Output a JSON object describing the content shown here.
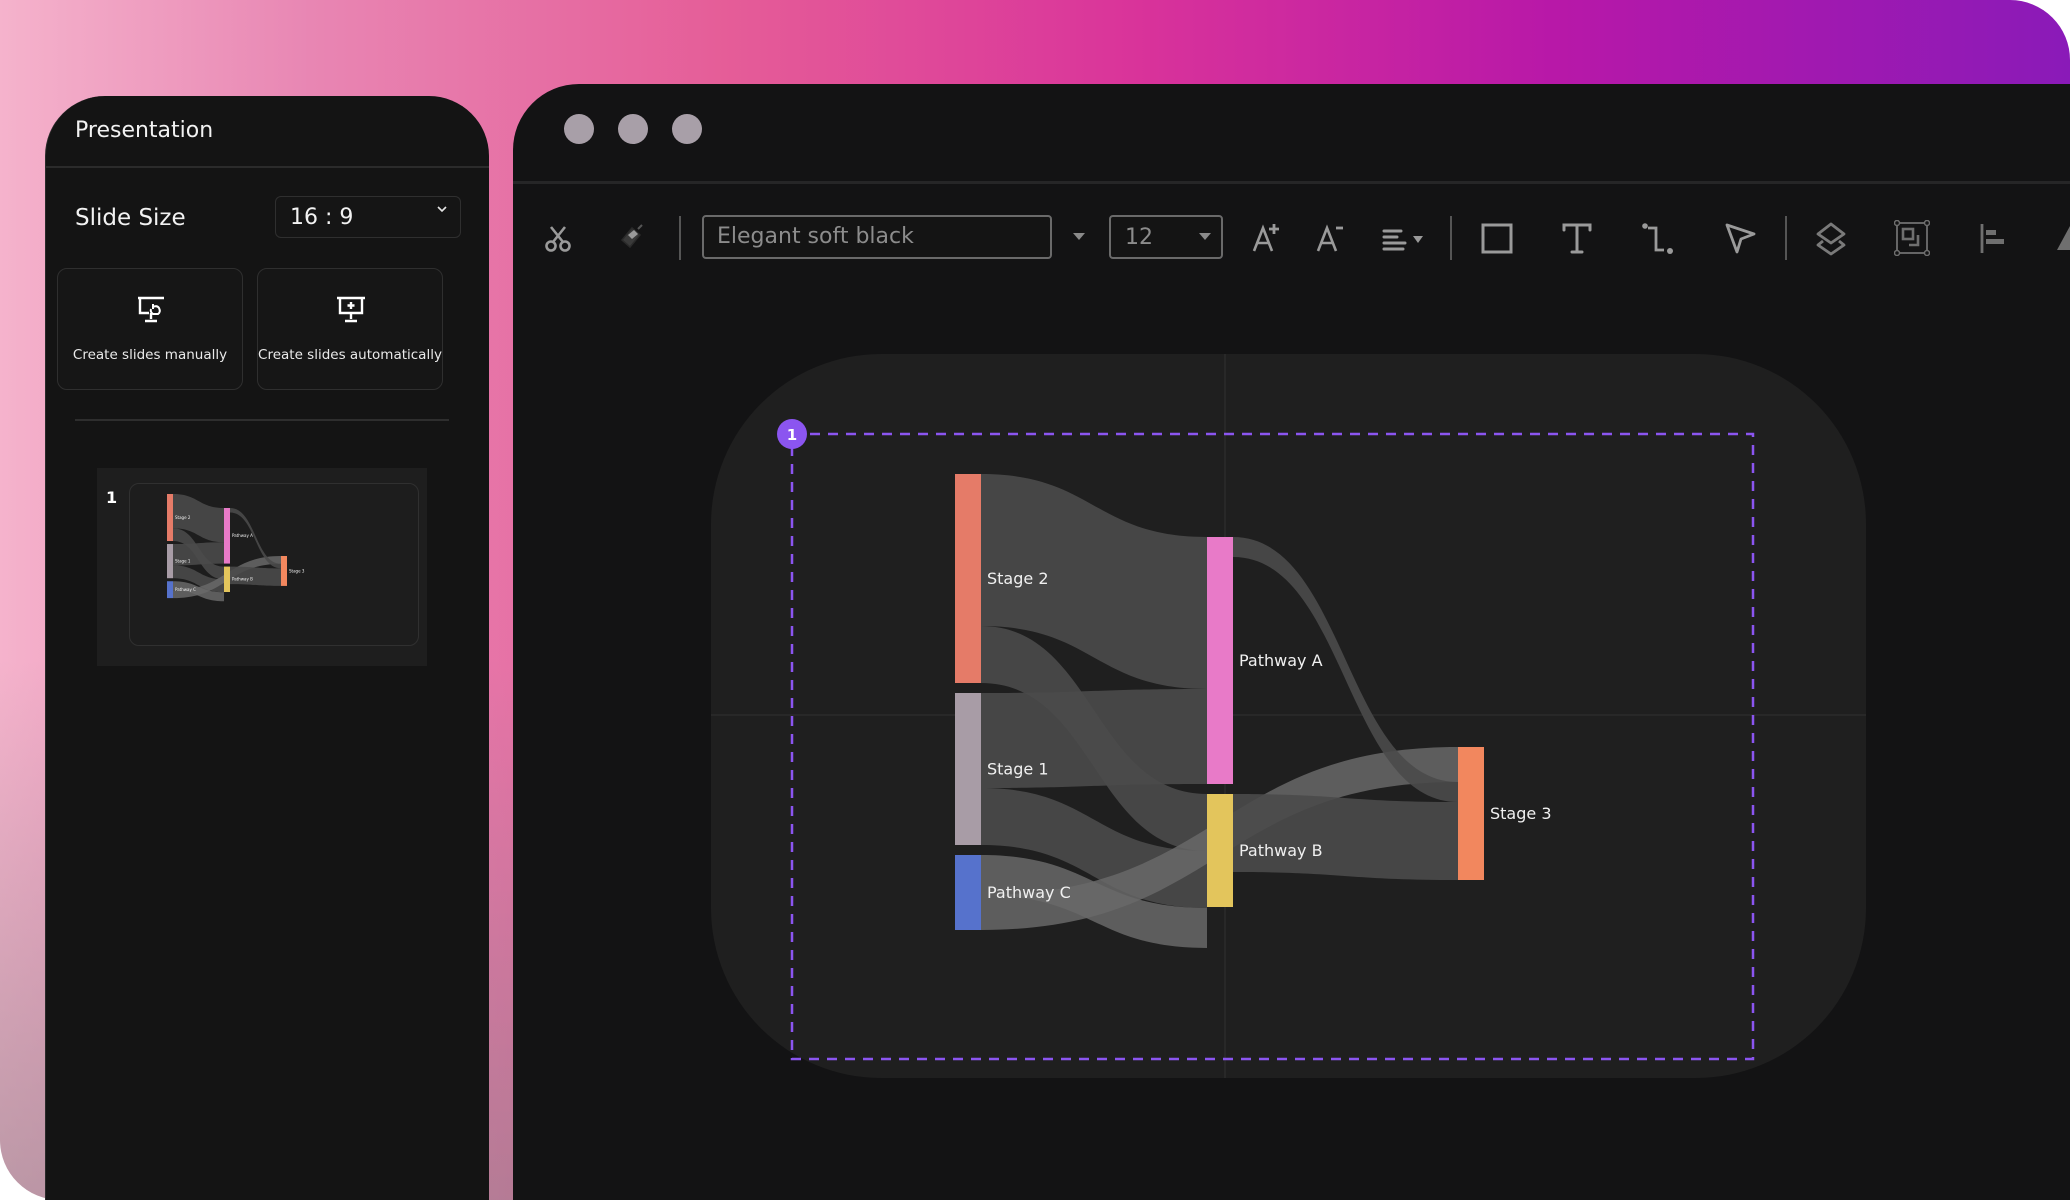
{
  "left_panel": {
    "title": "Presentation",
    "slide_size_label": "Slide Size",
    "slide_size_value": "16 : 9",
    "create_manual_label": "Create slides manually",
    "create_auto_label": "Create slides automatically",
    "thumbnails": [
      {
        "number": "1"
      }
    ]
  },
  "window": {
    "traffic_lights": [
      "close",
      "minimize",
      "maximize"
    ]
  },
  "toolbar": {
    "icons_left": [
      "scissors-icon",
      "format-painter-icon"
    ],
    "font_value": "Elegant soft black",
    "font_size_value": "12",
    "icons_right": [
      "increase-font-icon",
      "decrease-font-icon",
      "align-icon",
      "rectangle-icon",
      "text-icon",
      "connector-icon",
      "pointer-icon",
      "layers-icon",
      "group-icon",
      "align-left-icon",
      "shape-icon"
    ]
  },
  "canvas": {
    "selection_badge": "1"
  },
  "colors": {
    "accent": "#8b55f0",
    "stage2": "#e57b68",
    "stage1": "#a89ca6",
    "pathway_c": "#5672cc",
    "pathway_a": "#e87ac8",
    "pathway_b": "#e3c55c",
    "stage3": "#f2875e",
    "link": "#4a4a4a",
    "link_light": "#686868"
  },
  "chart_data": {
    "type": "sankey",
    "title": "",
    "nodes": [
      {
        "id": "stage2",
        "label": "Stage 2",
        "column": 0,
        "color": "#e57b68"
      },
      {
        "id": "stage1",
        "label": "Stage 1",
        "column": 0,
        "color": "#a89ca6"
      },
      {
        "id": "pathwayC",
        "label": "Pathway C",
        "column": 0,
        "color": "#5672cc"
      },
      {
        "id": "pathwayA",
        "label": "Pathway A",
        "column": 1,
        "color": "#e87ac8"
      },
      {
        "id": "pathwayB",
        "label": "Pathway B",
        "column": 1,
        "color": "#e3c55c"
      },
      {
        "id": "stage3",
        "label": "Stage 3",
        "column": 2,
        "color": "#f2875e"
      }
    ],
    "links": [
      {
        "source": "stage2",
        "target": "pathwayA",
        "value": 152
      },
      {
        "source": "stage2",
        "target": "pathwayB",
        "value": 57
      },
      {
        "source": "stage1",
        "target": "pathwayA",
        "value": 95
      },
      {
        "source": "stage1",
        "target": "pathwayB",
        "value": 57
      },
      {
        "source": "pathwayC",
        "target": "pathwayB",
        "value": 40
      },
      {
        "source": "pathwayC",
        "target": "stage3",
        "value": 35
      },
      {
        "source": "pathwayA",
        "target": "stage3",
        "value": 20
      },
      {
        "source": "pathwayB",
        "target": "stage3",
        "value": 78
      }
    ],
    "node_values": {
      "stage2": 209,
      "stage1": 152,
      "pathwayC": 75,
      "pathwayA": 247,
      "pathwayB": 113,
      "stage3": 133
    }
  }
}
